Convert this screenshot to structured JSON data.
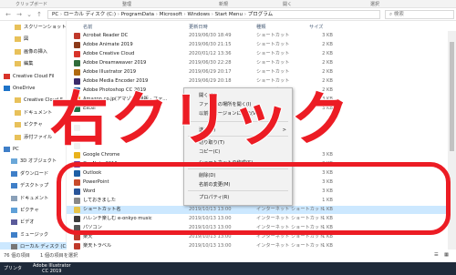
{
  "ribbon": {
    "group1": "クリップボード",
    "group2": "整理",
    "group3": "新規",
    "group4": "開く",
    "group5": "選択"
  },
  "address": {
    "parts": [
      "PC",
      "ローカル ディスク (C:)",
      "ProgramData",
      "Microsoft",
      "Windows",
      "Start Menu",
      "プログラム"
    ],
    "separator": " › "
  },
  "search": {
    "placeholder": "検索"
  },
  "nav": {
    "items": [
      {
        "label": "スクリーンショット",
        "icon": "folder-icon"
      },
      {
        "label": "図",
        "icon": "folder-icon"
      },
      {
        "label": "画像の挿入",
        "icon": "folder-icon"
      },
      {
        "label": "編集",
        "icon": "folder-icon"
      },
      {
        "label": "Creative Cloud Fil",
        "icon": "creative-cloud-icon"
      },
      {
        "label": "OneDrive",
        "icon": "onedrive-icon"
      },
      {
        "label": "Creative Cloud F",
        "icon": "folder-icon"
      },
      {
        "label": "ドキュメント",
        "icon": "folder-icon"
      },
      {
        "label": "ピクチャ",
        "icon": "folder-icon"
      },
      {
        "label": "添付ファイル",
        "icon": "folder-icon"
      },
      {
        "label": "PC",
        "icon": "pc-icon"
      },
      {
        "label": "3D オブジェクト",
        "icon": "cube-icon"
      },
      {
        "label": "ダウンロード",
        "icon": "download-icon"
      },
      {
        "label": "デスクトップ",
        "icon": "desktop-icon"
      },
      {
        "label": "ドキュメント",
        "icon": "document-icon"
      },
      {
        "label": "ピクチャ",
        "icon": "picture-icon"
      },
      {
        "label": "ビデオ",
        "icon": "video-icon"
      },
      {
        "label": "ミュージック",
        "icon": "music-icon"
      },
      {
        "label": "ローカル ディスク (C:)",
        "icon": "drive-icon"
      }
    ]
  },
  "columns": {
    "name": "名前",
    "date": "更新日時",
    "type": "種類",
    "size": "サイズ"
  },
  "files": [
    {
      "name": "Acrobat Reader DC",
      "date": "2019/06/30 18:49",
      "type": "ショートカット",
      "size": "3 KB",
      "color": "#c0392b"
    },
    {
      "name": "Adobe Animate 2019",
      "date": "2019/06/30 21:15",
      "type": "ショートカット",
      "size": "2 KB",
      "color": "#8b3a1a"
    },
    {
      "name": "Adobe Creative Cloud",
      "date": "2020/01/12 13:36",
      "type": "ショートカット",
      "size": "2 KB",
      "color": "#d8342a"
    },
    {
      "name": "Adobe Dreamweaver 2019",
      "date": "2019/06/30 22:28",
      "type": "ショートカット",
      "size": "2 KB",
      "color": "#2f6b3a"
    },
    {
      "name": "Adobe Illustrator 2019",
      "date": "2019/06/29 20:17",
      "type": "ショートカット",
      "size": "2 KB",
      "color": "#b06a10"
    },
    {
      "name": "Adobe Media Encoder 2019",
      "date": "2019/06/29 20:18",
      "type": "ショートカット",
      "size": "2 KB",
      "color": "#3a2a6a"
    },
    {
      "name": "Adobe Photoshop CC 2019",
      "date": "2019/06/29 19:57",
      "type": "ショートカット",
      "size": "2 KB",
      "color": "#1f5fa6"
    },
    {
      "name": "Amazon.co.jp(アマゾン) 通販 - ファ...",
      "date": "",
      "type": "",
      "size": "3 KB",
      "color": "#f39c12"
    },
    {
      "name": "Excel",
      "date": "",
      "type": "",
      "size": "3 KB",
      "color": "#1d7044"
    },
    {
      "name": "",
      "date": "",
      "type": "",
      "size": "",
      "color": "#f0f0f0"
    },
    {
      "name": "",
      "date": "",
      "type": "",
      "size": "",
      "color": "#f0f0f0"
    },
    {
      "name": "",
      "date": "",
      "type": "",
      "size": "",
      "color": "#f0f0f0"
    },
    {
      "name": "",
      "date": "",
      "type": "",
      "size": "",
      "color": "#f0f0f0"
    },
    {
      "name": "Google Chrome",
      "date": "",
      "type": "",
      "size": "3 KB",
      "color": "#e9b21c"
    },
    {
      "name": "OneNote 2016",
      "date": "",
      "type": "",
      "size": "3 KB",
      "color": "#7b3b9a"
    },
    {
      "name": "Outlook",
      "date": "",
      "type": "",
      "size": "3 KB",
      "color": "#1d5fa6"
    },
    {
      "name": "PowerPoint",
      "date": "",
      "type": "",
      "size": "3 KB",
      "color": "#c84b2b"
    },
    {
      "name": "Word",
      "date": "",
      "type": "",
      "size": "3 KB",
      "color": "#2a5599"
    },
    {
      "name": "しておきました",
      "date": "",
      "type": "",
      "size": "1 KB",
      "color": "#888888"
    },
    {
      "name": "ショートカット名",
      "date": "2019/10/13 13:00",
      "type": "インターネット ショートカット",
      "size": "1 KB",
      "color": "#e6c34a"
    },
    {
      "name": "ハレンチ楽しむ e-onkyo music",
      "date": "2019/10/13 13:00",
      "type": "インターネット ショートカット",
      "size": "1 KB",
      "color": "#3a3a3a"
    },
    {
      "name": "パソコン",
      "date": "2019/10/13 13:00",
      "type": "インターネット ショートカット",
      "size": "1 KB",
      "color": "#555555"
    },
    {
      "name": "楽天",
      "date": "2019/10/13 13:00",
      "type": "インターネット ショートカット",
      "size": "1 KB",
      "color": "#c0392b"
    },
    {
      "name": "楽天トラベル",
      "date": "2019/10/13 13:00",
      "type": "インターネット ショートカット",
      "size": "1 KB",
      "color": "#c0392b"
    }
  ],
  "context_menu": {
    "items": [
      {
        "label": "開く(O)",
        "arrow": ""
      },
      {
        "label": "ファイルの場所を開く(I)",
        "arrow": ""
      },
      {
        "label": "以前のバージョンに復元(V)",
        "arrow": ""
      },
      {
        "label": "送る(N)",
        "arrow": ">"
      },
      {
        "label": "切り取り(T)",
        "arrow": ""
      },
      {
        "label": "コピー(C)",
        "arrow": ""
      },
      {
        "label": "ショートカットの作成(S)",
        "arrow": ""
      },
      {
        "label": "削除(D)",
        "arrow": ""
      },
      {
        "label": "名前の変更(M)",
        "arrow": ""
      },
      {
        "label": "プロパティ(R)",
        "arrow": ""
      }
    ]
  },
  "overlay": {
    "text": "右クリック"
  },
  "status": {
    "count": "76 個の項目",
    "selected": "1 個の項目を選択"
  },
  "taskbar": {
    "item1": "プリンタ",
    "item2_line1": "Adobe Illustrator",
    "item2_line2": "CC 2019"
  },
  "colors": {
    "accent": "#ec1c24",
    "selection": "#cce8ff",
    "menu": "#f2f2f2"
  }
}
